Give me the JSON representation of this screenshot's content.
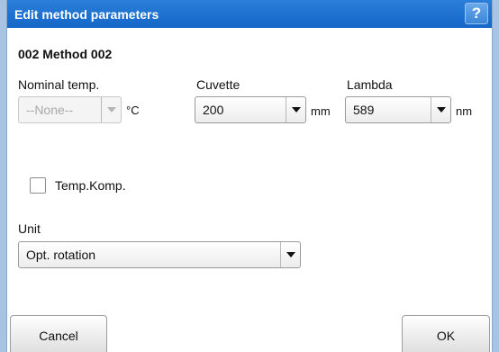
{
  "dialog": {
    "title": "Edit method parameters",
    "help_label": "?"
  },
  "method": {
    "name": "002 Method 002"
  },
  "fields": {
    "nominal_temp": {
      "label": "Nominal temp.",
      "value": "--None--",
      "unit": "°C",
      "enabled": false
    },
    "cuvette": {
      "label": "Cuvette",
      "value": "200",
      "unit": "mm"
    },
    "lambda": {
      "label": "Lambda",
      "value": "589",
      "unit": "nm"
    },
    "temp_komp": {
      "label": "Temp.Komp.",
      "checked": false
    },
    "unit": {
      "label": "Unit",
      "value": "Opt. rotation"
    }
  },
  "buttons": {
    "cancel": "Cancel",
    "ok": "OK"
  },
  "colors": {
    "titlebar": "#1a6fd0",
    "background": "#a9c3e2"
  }
}
